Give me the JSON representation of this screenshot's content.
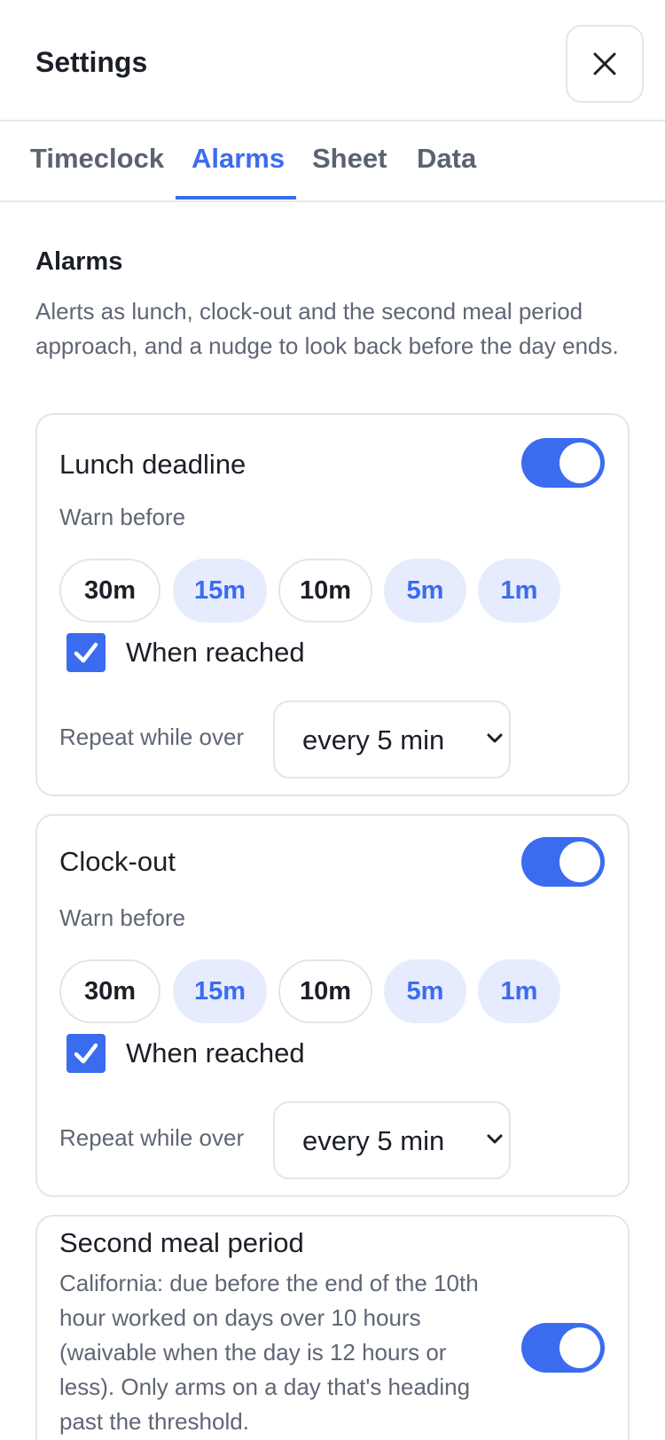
{
  "header": {
    "title": "Settings",
    "close_icon": "close-icon"
  },
  "tabs": [
    {
      "label": "Timeclock",
      "active": false
    },
    {
      "label": "Alarms",
      "active": true
    },
    {
      "label": "Sheet",
      "active": false
    },
    {
      "label": "Data",
      "active": false
    }
  ],
  "section": {
    "title": "Alarms",
    "description": "Alerts as lunch, clock-out and the second meal period approach, and a nudge to look back before the day ends."
  },
  "cards": [
    {
      "title": "Lunch deadline",
      "enabled": true,
      "warn_label": "Warn before",
      "chips": [
        {
          "label": "30m",
          "selected": false
        },
        {
          "label": "15m",
          "selected": true
        },
        {
          "label": "10m",
          "selected": false
        },
        {
          "label": "5m",
          "selected": true
        },
        {
          "label": "1m",
          "selected": true
        }
      ],
      "when_reached_label": "When reached",
      "when_reached_checked": true,
      "repeat_label": "Repeat while over",
      "repeat_value": "every 5 min"
    },
    {
      "title": "Clock-out",
      "enabled": true,
      "warn_label": "Warn before",
      "chips": [
        {
          "label": "30m",
          "selected": false
        },
        {
          "label": "15m",
          "selected": true
        },
        {
          "label": "10m",
          "selected": false
        },
        {
          "label": "5m",
          "selected": true
        },
        {
          "label": "1m",
          "selected": true
        }
      ],
      "when_reached_label": "When reached",
      "when_reached_checked": true,
      "repeat_label": "Repeat while over",
      "repeat_value": "every 5 min"
    }
  ],
  "second_meal": {
    "title": "Second meal period",
    "description": "California: due before the end of the 10th hour worked on days over 10 hours (waivable when the day is 12 hours or less). Only arms on a day that's heading past the threshold.",
    "enabled": true
  },
  "colors": {
    "accent": "#3b6cf0",
    "chip_selected_bg": "#e6ecfd",
    "border": "#e2e5ea",
    "muted_text": "#5f6675"
  }
}
